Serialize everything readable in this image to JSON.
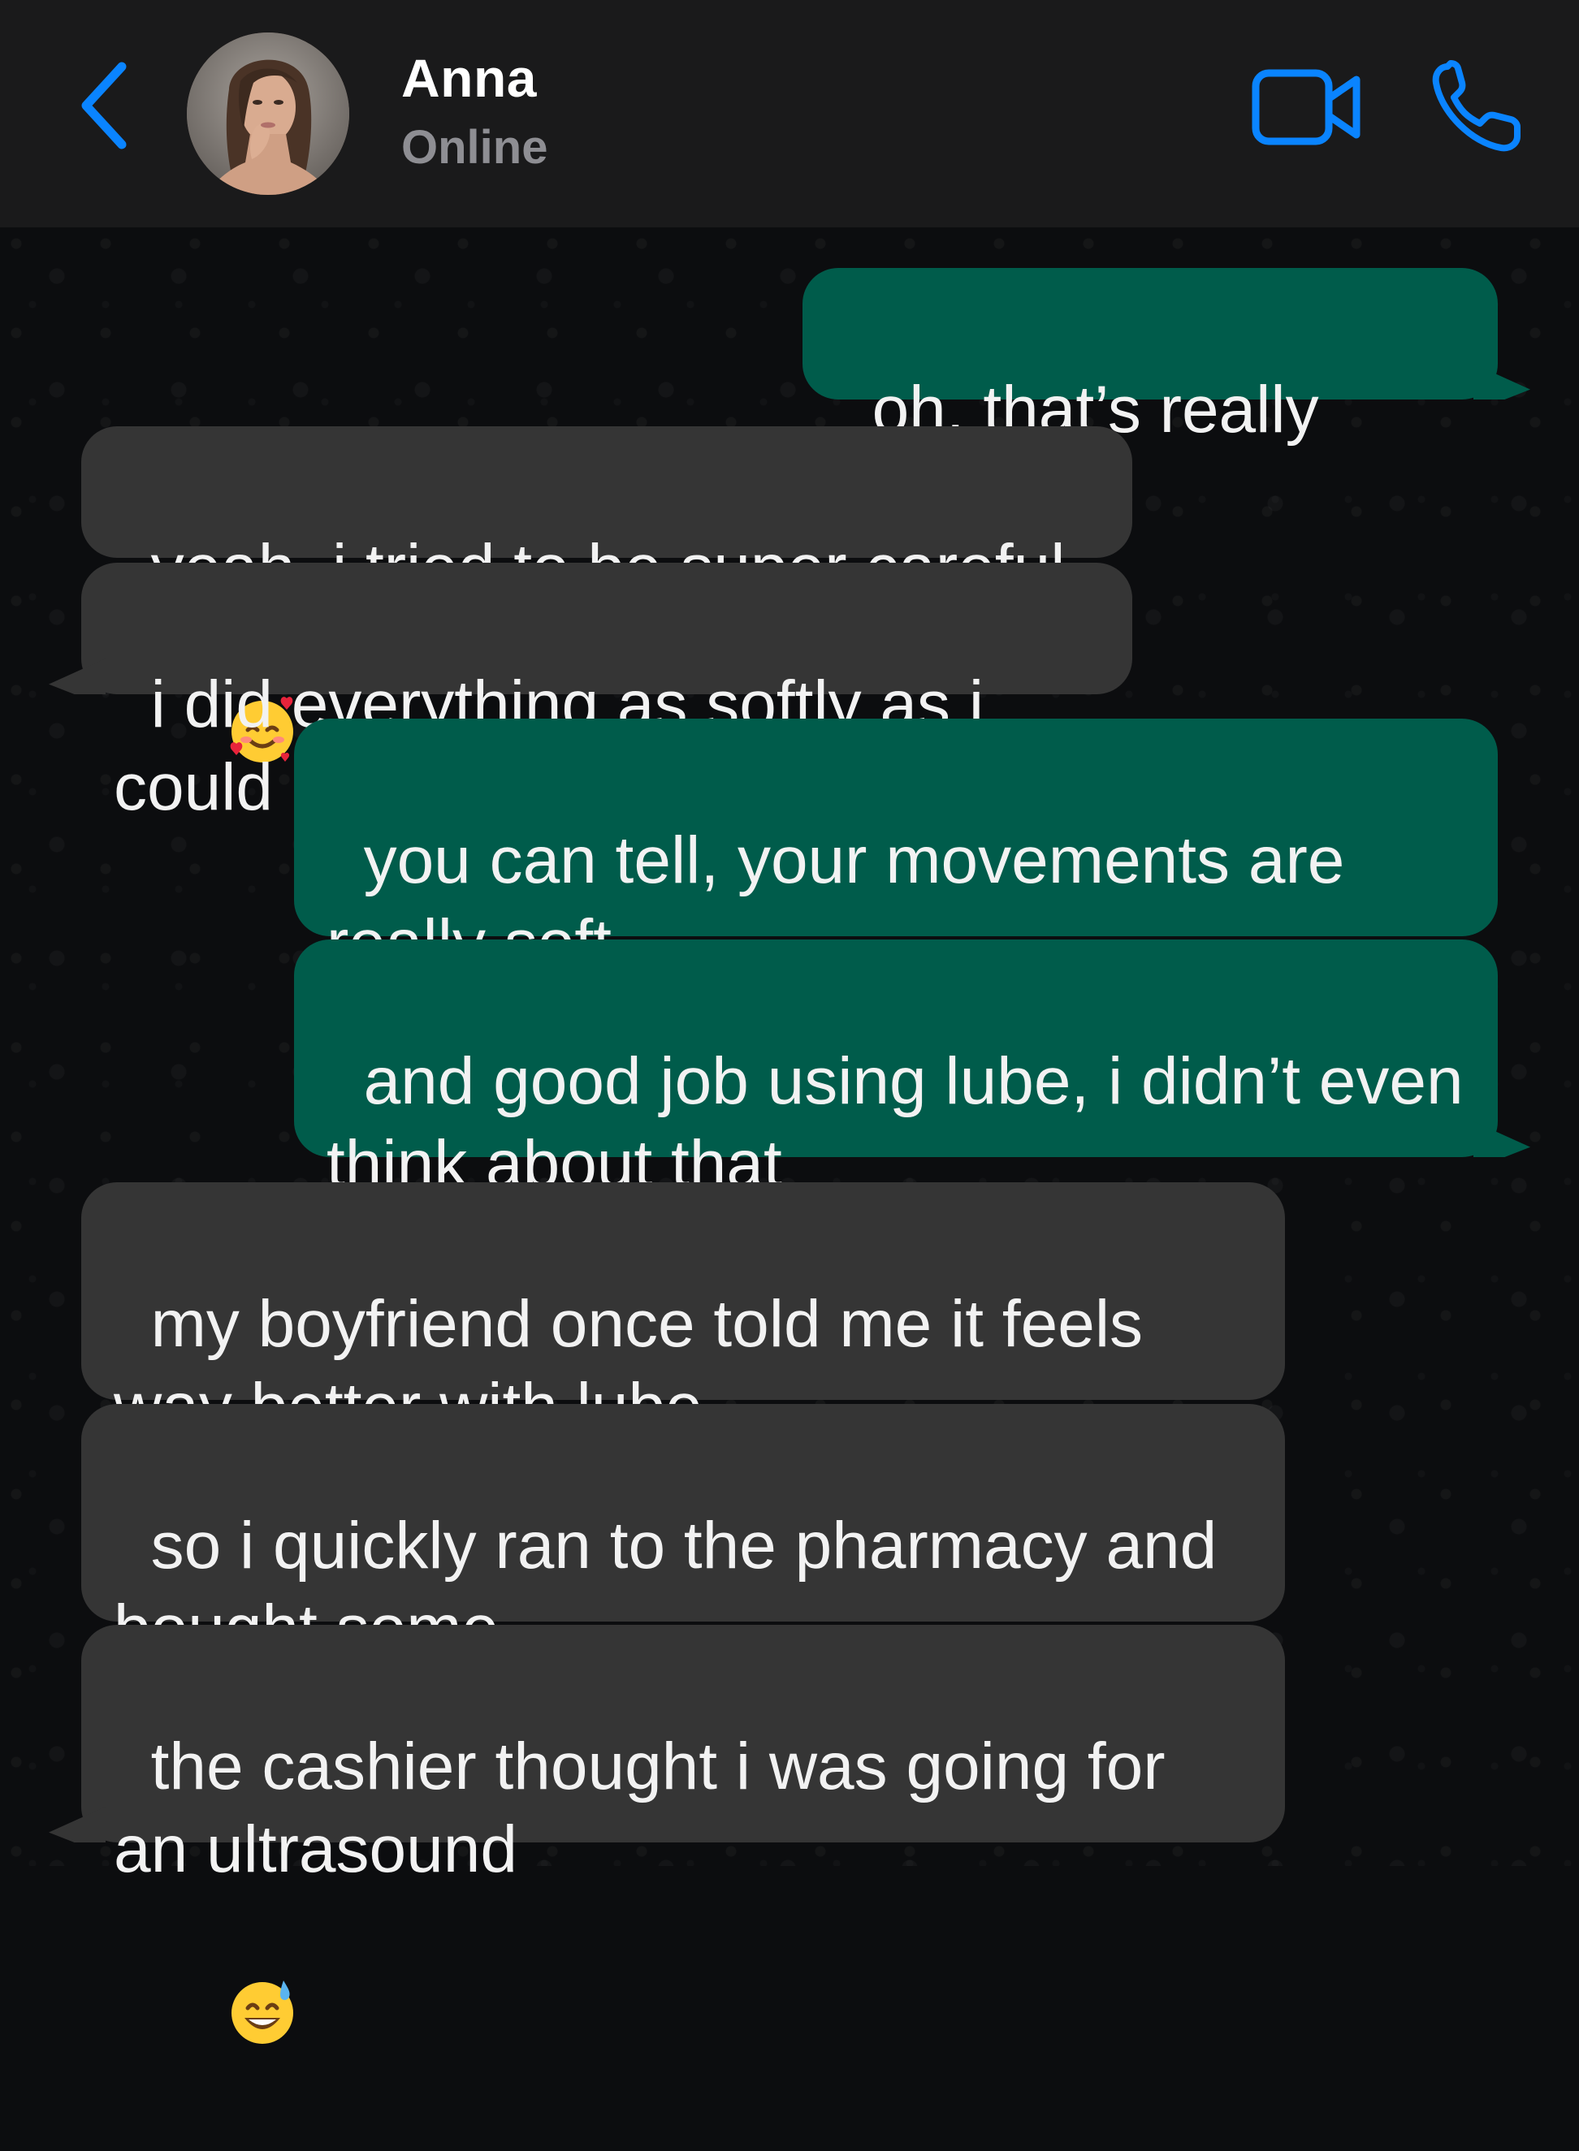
{
  "header": {
    "contact_name": "Anna",
    "contact_status": "Online",
    "accent_color": "#0a84ff"
  },
  "messages": [
    {
      "direction": "out",
      "text": "oh, that’s really gentle"
    },
    {
      "direction": "in",
      "text": "yeah, i tried to be super careful",
      "emoji": "smiling-face-with-hearts"
    },
    {
      "direction": "in",
      "text": "i did everything as softly as i could"
    },
    {
      "direction": "out",
      "text": "you can tell, your movements are really soft"
    },
    {
      "direction": "out",
      "text": "and good job using lube, i didn’t even think about that"
    },
    {
      "direction": "in",
      "text": "my boyfriend once told me it feels way better with lube"
    },
    {
      "direction": "in",
      "text": "so i quickly ran to the pharmacy and bought some"
    },
    {
      "direction": "in",
      "text": "the cashier thought i was going for an ultrasound",
      "emoji": "grinning-face-with-sweat"
    }
  ],
  "colors": {
    "outgoing_bubble": "#005c4b",
    "incoming_bubble": "#353535",
    "header_bg": "#1a1a1b"
  }
}
